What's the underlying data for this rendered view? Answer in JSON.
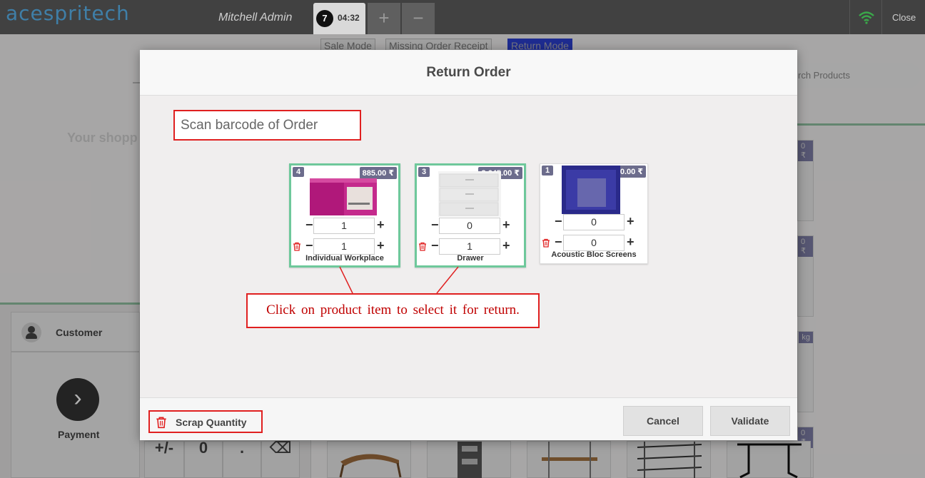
{
  "header": {
    "logo": "acespritech",
    "cashier": "Mitchell Admin",
    "order_number": "7",
    "order_time": "04:32",
    "add_label": "+",
    "remove_label": "−",
    "close_label": "Close"
  },
  "background": {
    "modes": [
      "Sale Mode",
      "Missing Order Receipt",
      "Return Mode"
    ],
    "active_mode": "Return Mode",
    "search_placeholder": "Search Products",
    "search_visible": "rch Products",
    "cart_empty_text": "Your shopp",
    "customer_label": "Customer",
    "payment_label": "Payment",
    "keypad": [
      "+/-",
      "0",
      ".",
      "⌫"
    ],
    "side_badges": [
      "0 ₹",
      "0 ₹",
      "kg",
      "0 ₹"
    ]
  },
  "modal": {
    "title": "Return Order",
    "scan_placeholder": "Scan barcode of Order",
    "products": [
      {
        "name": "Individual Workplace",
        "qty_badge": "4",
        "price": "885.00 ₹",
        "return_qty": "1",
        "scrap_qty": "1",
        "selected": true
      },
      {
        "name": "Drawer",
        "qty_badge": "3",
        "price": "3,645.00 ₹",
        "return_qty": "0",
        "scrap_qty": "1",
        "selected": true
      },
      {
        "name": "Acoustic Bloc Screens",
        "qty_badge": "1",
        "price": "2,950.00 ₹",
        "return_qty": "0",
        "scrap_qty": "0",
        "selected": false
      }
    ],
    "callout_text": "Click on product item to select it for return.",
    "scrap_label": "Scrap Quantity",
    "cancel_label": "Cancel",
    "validate_label": "Validate"
  },
  "colors": {
    "accent_red": "#e02020",
    "selected_green": "#6ec89b",
    "badge": "#6c6c8c",
    "topbar": "#414141"
  }
}
